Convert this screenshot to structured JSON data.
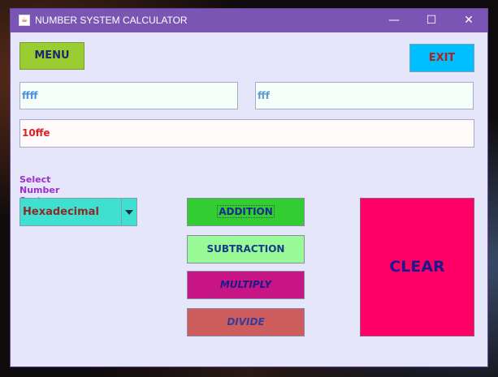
{
  "window": {
    "title": "NUMBER SYSTEM CALCULATOR"
  },
  "controls": {
    "minimize": "—",
    "maximize": "☐",
    "close": "✕"
  },
  "menu": {
    "label": "MENU"
  },
  "exit": {
    "label": "EXIT"
  },
  "inputs": {
    "first": "ffff",
    "second": "fff"
  },
  "result": {
    "value": "10ffe"
  },
  "select": {
    "label": "Select Number System :",
    "value": "Hexadecimal"
  },
  "operations": {
    "addition": "ADDITION",
    "subtraction": "SUBTRACTION",
    "multiply": "MULTIPLY",
    "divide": "DIVIDE"
  },
  "clear": {
    "label": "CLEAR"
  },
  "colors": {
    "titlebar": "#7a55b4",
    "window_bg": "#e6e6fa",
    "menu": "#9acd32",
    "exit": "#00bfff",
    "combo": "#40e0d0",
    "addition": "#32cd32",
    "subtraction": "#98fb98",
    "multiply": "#c71585",
    "divide": "#cd5c5c",
    "clear": "#ff0066"
  }
}
